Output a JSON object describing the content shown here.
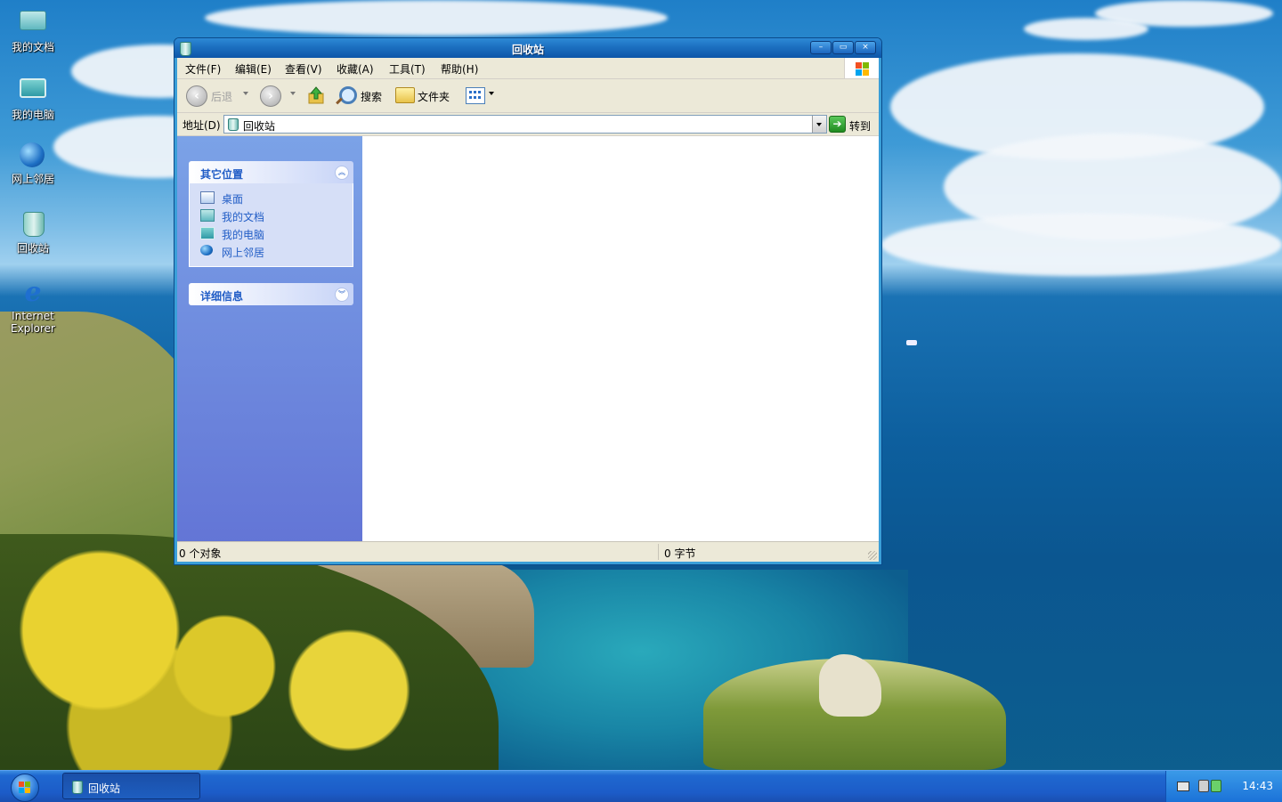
{
  "desktop": {
    "icons": [
      {
        "label": "我的文档",
        "icon": "my-documents-icon"
      },
      {
        "label": "我的电脑",
        "icon": "my-computer-icon"
      },
      {
        "label": "网上邻居",
        "icon": "network-places-icon"
      },
      {
        "label": "回收站",
        "icon": "recycle-bin-icon"
      },
      {
        "label_line1": "Internet",
        "label_line2": "Explorer",
        "icon": "internet-explorer-icon"
      }
    ]
  },
  "window": {
    "title": "回收站",
    "buttons": {
      "minimize": "–",
      "maximize": "▭",
      "close": "×"
    },
    "menu": [
      "文件(F)",
      "编辑(E)",
      "查看(V)",
      "收藏(A)",
      "工具(T)",
      "帮助(H)"
    ],
    "toolbar": {
      "back_label": "后退",
      "search_label": "搜索",
      "folders_label": "文件夹"
    },
    "address": {
      "label": "地址(D)",
      "value": "回收站",
      "go_label": "转到"
    },
    "taskpane": {
      "other_places": {
        "title": "其它位置",
        "items": [
          {
            "label": "桌面",
            "icon": "desktop-icon"
          },
          {
            "label": "我的文档",
            "icon": "my-documents-icon"
          },
          {
            "label": "我的电脑",
            "icon": "my-computer-icon"
          },
          {
            "label": "网上邻居",
            "icon": "network-places-icon"
          }
        ]
      },
      "details": {
        "title": "详细信息"
      }
    },
    "status": {
      "objects": "0 个对象",
      "size": "0 字节"
    }
  },
  "taskbar": {
    "task_label": "回收站",
    "clock": "14:43"
  },
  "colors": {
    "titlebar": "#1c6fc0",
    "taskpane": "#7ba2e7",
    "panel_link": "#215dc6",
    "taskbar": "#1c5cc8"
  }
}
